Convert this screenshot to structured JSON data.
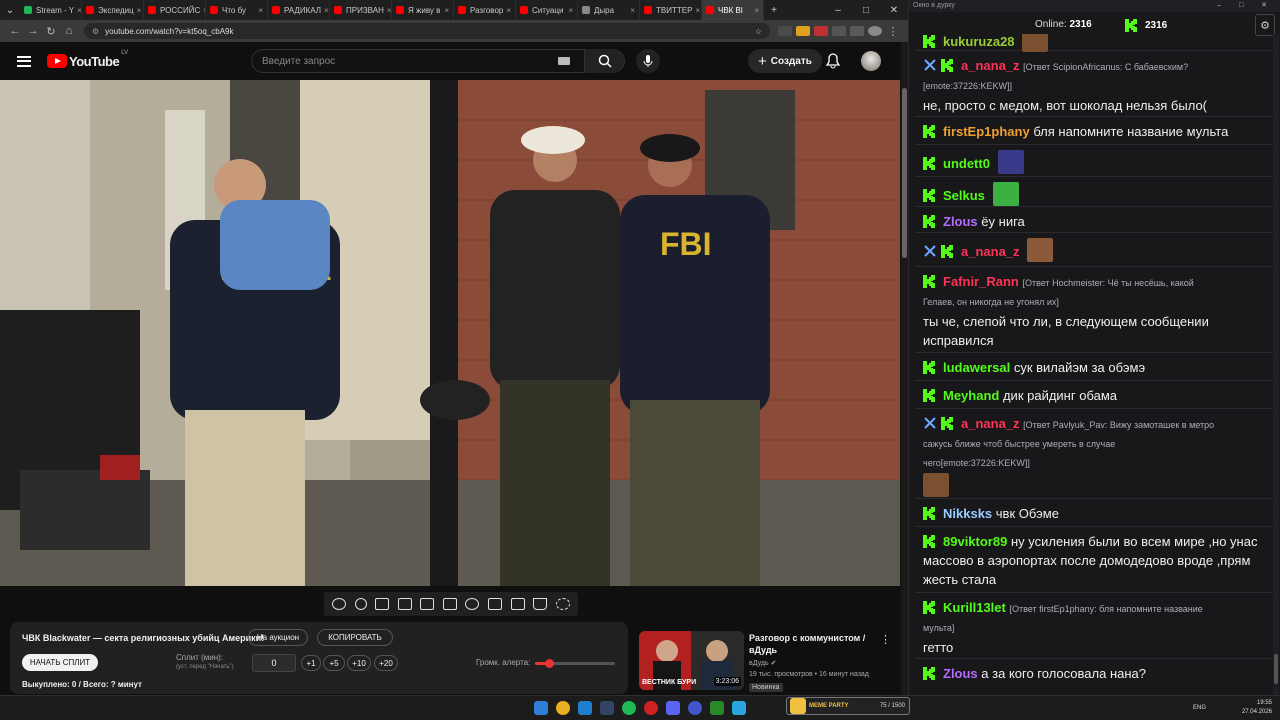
{
  "browser": {
    "tabs": [
      {
        "label": "Stream - Y",
        "color": "#1db954"
      },
      {
        "label": "Экспедиц",
        "color": "#ff0000"
      },
      {
        "label": "РОССИЙС",
        "color": "#ff0000"
      },
      {
        "label": "Что бу",
        "color": "#ff0000"
      },
      {
        "label": "РАДИКАЛ",
        "color": "#ff0000"
      },
      {
        "label": "ПРИЗВАН",
        "color": "#ff0000"
      },
      {
        "label": "Я живу в",
        "color": "#ff0000"
      },
      {
        "label": "Разговор",
        "color": "#ff0000"
      },
      {
        "label": "Ситуаци",
        "color": "#ff0000"
      },
      {
        "label": "Дыра",
        "color": "#888888"
      },
      {
        "label": "ТВИТТЕР",
        "color": "#ff0000"
      },
      {
        "label": "ЧВК Bl",
        "color": "#ff0000",
        "active": true
      }
    ],
    "url": "youtube.com/watch?v=kt5oq_cbA9k"
  },
  "youtube": {
    "logo_text": "YouTube",
    "region": "LV",
    "search_placeholder": "Введите запрос",
    "create_label": "Создать"
  },
  "panel": {
    "title": "ЧВК Blackwater — секта религиозных убийц Америки!",
    "auction_label": "На аукцион",
    "copy_label": "КОПИРОВАТЬ",
    "start_split_label": "НАЧАТЬ СПЛИТ",
    "split_label": "Сплит (мин):",
    "split_hint": "(уст. перед \"Начать\")",
    "split_value": "0",
    "increments": [
      "+1",
      "+5",
      "+10",
      "+20"
    ],
    "alert_volume_label": "Громк. алерта:",
    "alert_volume": 0.18,
    "bought_label": "Выкуплено: 0 / Всего: ? минут"
  },
  "recommendation": {
    "title": "Разговор с коммунистом / вДудь",
    "channel": "вДудь",
    "meta": "19 тыс. просмотров • 16 минут назад",
    "badge": "Новинка",
    "duration": "3:23:06",
    "thumb_caption": "ВЕСТНИК БУРИ"
  },
  "chat": {
    "window_title": "Окно в дурку",
    "online_label": "Online:",
    "online_count": "2316",
    "kick_count": "2316",
    "messages": [
      {
        "user": "kukuruza28",
        "color": "#9acd32",
        "text": "",
        "emote": true
      },
      {
        "user": "a_nana_z",
        "color": "#ff3355",
        "reply": "[Ответ ScipionAfricanus: С бабаевским?",
        "reply2": "[emote:37226:KEKW]]",
        "text": "не, просто с медом, вот шоколад нельзя было(",
        "swords": true
      },
      {
        "user": "firstEp1phany",
        "color": "#f0a030",
        "text": "бля напомните название мульта"
      },
      {
        "user": "undett0",
        "color": "#53fc18",
        "text": "",
        "emote": true
      },
      {
        "user": "Selkus",
        "color": "#53fc18",
        "text": "",
        "emote": true
      },
      {
        "user": "Zlous",
        "color": "#b36bff",
        "text": "ёу нига"
      },
      {
        "user": "a_nana_z",
        "color": "#ff3355",
        "text": "",
        "emote": true,
        "swords": true
      },
      {
        "user": "Fafnir_Rann",
        "color": "#ff3355",
        "reply": "[Ответ Hochmeister: Чё ты несёшь, какой",
        "reply2": "Гелаев, он никогда не угонял их]",
        "text": "ты че, слепой что ли, в следующем сообщении исправился"
      },
      {
        "user": "ludawersal",
        "color": "#53fc18",
        "text": "сук вилайэм за обэмэ"
      },
      {
        "user": "Meyhand",
        "color": "#53fc18",
        "text": "дик райдинг обама"
      },
      {
        "user": "a_nana_z",
        "color": "#ff3355",
        "reply": "[Ответ Pavlyuk_Pav: Вижу замоташек в метро",
        "reply2": "сажусь ближе чтоб быстрее умереть в случае",
        "reply3": "чего[emote:37226:KEKW]]",
        "swords": true
      },
      {
        "user": "Nikksks",
        "color": "#99ccff",
        "text": "чвк Обэме"
      },
      {
        "user": "89viktor89",
        "color": "#53fc18",
        "text": "ну усиления были во всем мире ,но унас массово в аэропортах после домодедово вроде ,прям жесть стала"
      },
      {
        "user": "Kurill13let",
        "color": "#53fc18",
        "reply": "[Ответ firstEp1phany: бля напомните название",
        "reply2": "мульта]",
        "text": "гетто"
      },
      {
        "user": "Zlous",
        "color": "#b36bff",
        "text": "а за кого голосовала нана?"
      }
    ]
  },
  "taskbar": {
    "lang": "ENG",
    "time": "19:55",
    "date": "27.04.2026",
    "meme_party": "MEME PARTY",
    "meme_count": "75 / 1500"
  }
}
